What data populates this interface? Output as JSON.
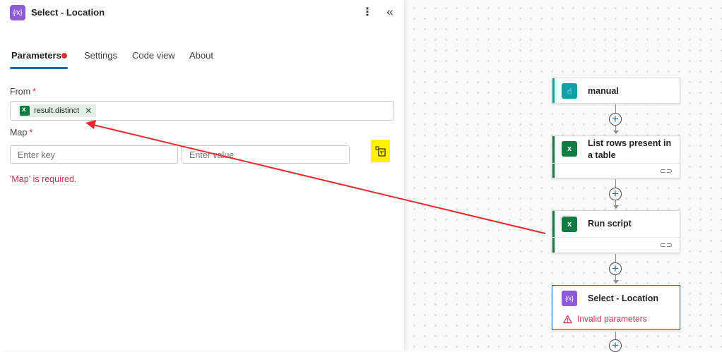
{
  "panel": {
    "title": "Select - Location",
    "header_icon": "{∕x}",
    "tabs": [
      {
        "label": "Parameters"
      },
      {
        "label": "Settings"
      },
      {
        "label": "Code view"
      },
      {
        "label": "About"
      }
    ],
    "from": {
      "label": "From",
      "required": "*",
      "token": "result.distinct"
    },
    "map": {
      "label": "Map",
      "required": "*",
      "key_placeholder": "Enter key",
      "value_placeholder": "Enter value"
    },
    "error": "'Map' is required."
  },
  "flow": {
    "cards": [
      {
        "title": "manual",
        "icon": "trigger-icon"
      },
      {
        "title": "List rows present in a table",
        "icon": "excel-icon"
      },
      {
        "title": "Run script",
        "icon": "excel-icon"
      },
      {
        "title": "Select - Location",
        "icon": "data-operation-icon",
        "warning": "Invalid parameters"
      }
    ]
  },
  "colors": {
    "accent_blue": "#0f6cbd",
    "error_red": "#c4314b",
    "excel_green": "#107c41",
    "trigger_teal": "#11a0a8",
    "data_op_purple": "#8e5bd8",
    "highlight_yellow": "#fff100",
    "annotation_red": "#e8282b"
  }
}
